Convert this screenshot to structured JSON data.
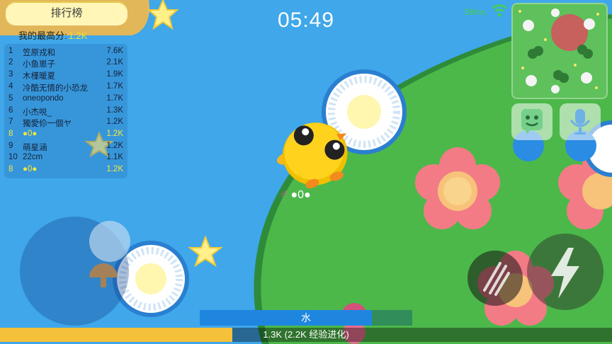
{
  "leaderboard": {
    "title": "排行榜",
    "my_best_label": "我的最高分:",
    "my_best_value": "1.2K",
    "entries": [
      {
        "rank": "1",
        "name": "笠原戎和",
        "score": "7.6K"
      },
      {
        "rank": "2",
        "name": "小鱼崽子",
        "score": "2.1K"
      },
      {
        "rank": "3",
        "name": "木槿暖夏",
        "score": "1.9K"
      },
      {
        "rank": "4",
        "name": "冷酷无情的小恐龙",
        "score": "1.7K"
      },
      {
        "rank": "5",
        "name": "oneopondo",
        "score": "1.7K"
      },
      {
        "rank": "6",
        "name": "小杰哾_",
        "score": "1.3K"
      },
      {
        "rank": "7",
        "name": "獨愛伱一個ヤ",
        "score": "1.2K"
      },
      {
        "rank": "8",
        "name": "●0●",
        "score": "1.2K"
      },
      {
        "rank": "9",
        "name": "萌星涵",
        "score": "1.2K"
      },
      {
        "rank": "10",
        "name": "22cm",
        "score": "1.1K"
      },
      {
        "rank": "8",
        "name": "●0●",
        "score": "1.2K"
      }
    ]
  },
  "timer": "05:49",
  "ping": "59ms",
  "player": {
    "gender_symbol": "♂",
    "name": "●0●"
  },
  "biome": {
    "label": "水",
    "fill_fraction": 0.81
  },
  "xp": {
    "label": "1.3K (2.2K 经验进化)",
    "fill_fraction": 0.38
  },
  "colors": {
    "water": "#3fa7ea",
    "land": "#4cb84a",
    "xp_fill": "#f5c13b",
    "biome_fill": "#1f86e0",
    "self_highlight": "#f4e83c"
  },
  "icons": {
    "emote": "smiley-icon",
    "voice": "microphone-icon",
    "boost": "lightning-icon",
    "skill": "claw-slash-icon",
    "wifi": "wifi-icon"
  }
}
